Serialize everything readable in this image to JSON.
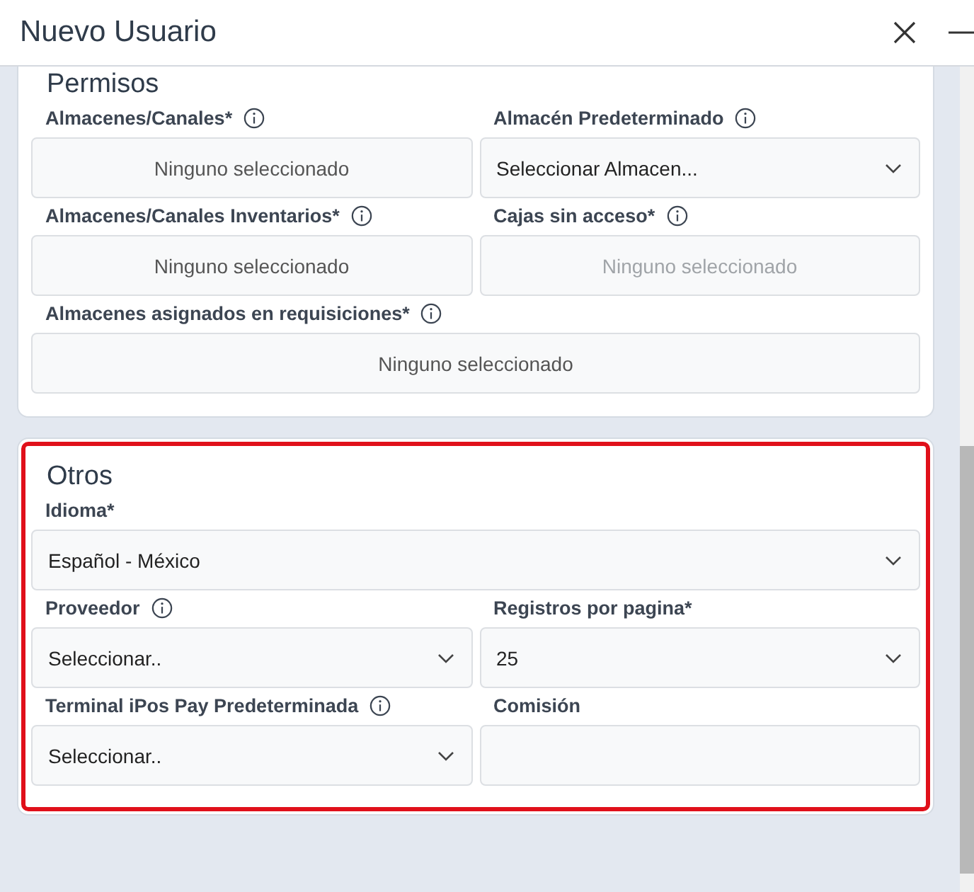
{
  "window": {
    "title": "Nuevo Usuario"
  },
  "sections": [
    {
      "title": "Permisos",
      "highlighted": false,
      "rows": [
        [
          {
            "label": "Almacenes/Canales*",
            "info": true,
            "kind": "multiselect",
            "text": "Ninguno seleccionado",
            "disabled": false
          },
          {
            "label": "Almacén Predeterminado",
            "info": true,
            "kind": "select",
            "text": "Seleccionar Almacen..."
          }
        ],
        [
          {
            "label": "Almacenes/Canales Inventarios*",
            "info": true,
            "kind": "multiselect",
            "text": "Ninguno seleccionado",
            "disabled": false
          },
          {
            "label": "Cajas sin acceso*",
            "info": true,
            "kind": "multiselect",
            "text": "Ninguno seleccionado",
            "disabled": true
          }
        ],
        [
          {
            "label": "Almacenes asignados en requisiciones*",
            "info": true,
            "kind": "multiselect",
            "text": "Ninguno seleccionado",
            "disabled": false
          }
        ]
      ]
    },
    {
      "title": "Otros",
      "highlighted": true,
      "rows": [
        [
          {
            "label": "Idioma*",
            "info": false,
            "kind": "select",
            "text": "Español - México"
          }
        ],
        [
          {
            "label": "Proveedor",
            "info": true,
            "kind": "select",
            "text": "Seleccionar.."
          },
          {
            "label": "Registros por pagina*",
            "info": false,
            "kind": "select",
            "text": "25"
          }
        ],
        [
          {
            "label": "Terminal iPos Pay Predeterminada",
            "info": true,
            "kind": "select",
            "text": "Seleccionar.."
          },
          {
            "label": "Comisión",
            "info": false,
            "kind": "input",
            "text": ""
          }
        ]
      ]
    }
  ]
}
